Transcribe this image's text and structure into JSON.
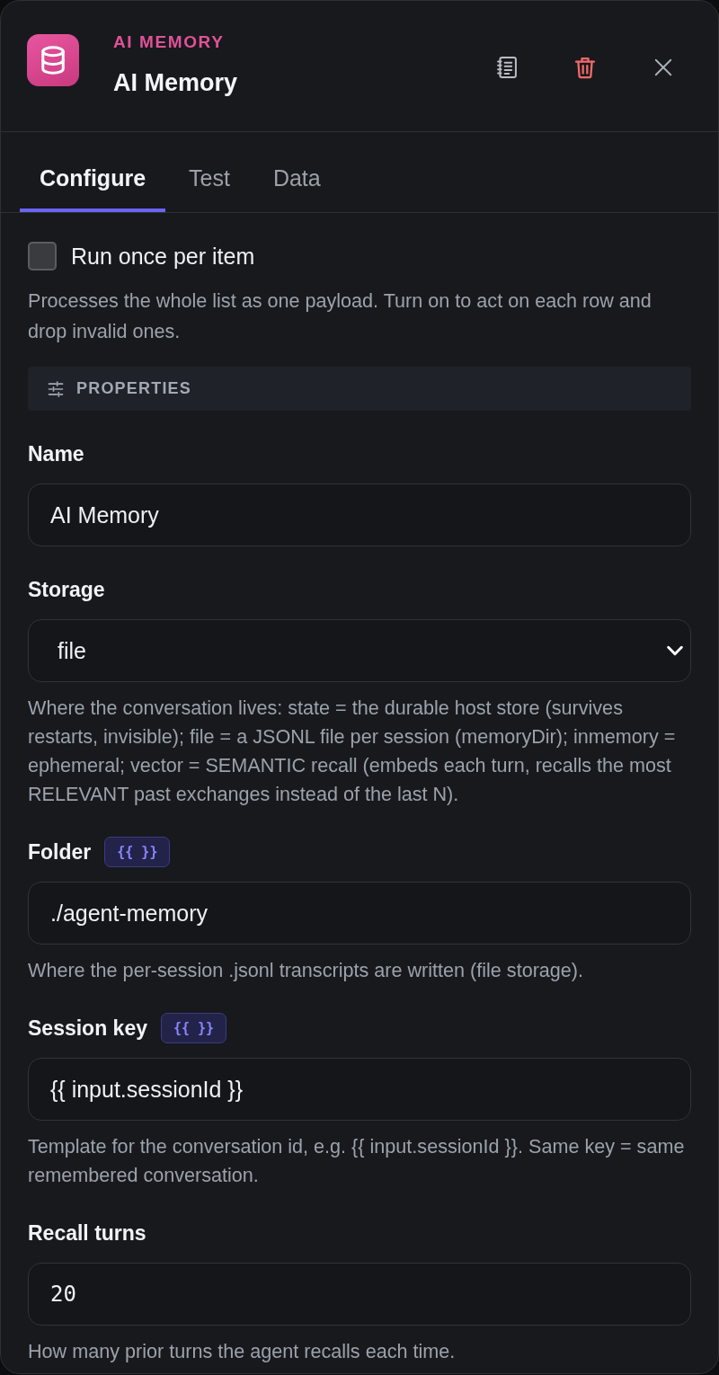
{
  "header": {
    "eyebrow": "AI MEMORY",
    "title": "AI Memory"
  },
  "tabs": [
    {
      "label": "Configure",
      "selected": true
    },
    {
      "label": "Test",
      "selected": false
    },
    {
      "label": "Data",
      "selected": false
    }
  ],
  "run_once": {
    "label": "Run once per item",
    "checked": false,
    "description": "Processes the whole list as one payload. Turn on to act on each row and drop invalid ones."
  },
  "section": {
    "title": "PROPERTIES"
  },
  "fields": [
    {
      "kind": "text",
      "label": "Name",
      "value": "AI Memory"
    },
    {
      "kind": "select",
      "label": "Storage",
      "value": "file",
      "description": "Where the conversation lives: state = the durable host store (survives restarts, invisible); file = a JSONL file per session (memoryDir); inmemory = ephemeral; vector = SEMANTIC recall (embeds each turn, recalls the most RELEVANT past exchanges instead of the last N)."
    },
    {
      "kind": "text",
      "label": "Folder",
      "template_badge": "{{ }}",
      "value": "./agent-memory",
      "description": "Where the per-session .jsonl transcripts are written (file storage)."
    },
    {
      "kind": "text",
      "label": "Session key",
      "template_badge": "{{ }}",
      "value": "{{ input.sessionId }}",
      "description": "Template for the conversation id, e.g. {{ input.sessionId }}. Same key = same remembered conversation."
    },
    {
      "kind": "number",
      "label": "Recall turns",
      "value": "20",
      "description": "How many prior turns the agent recalls each time."
    }
  ]
}
